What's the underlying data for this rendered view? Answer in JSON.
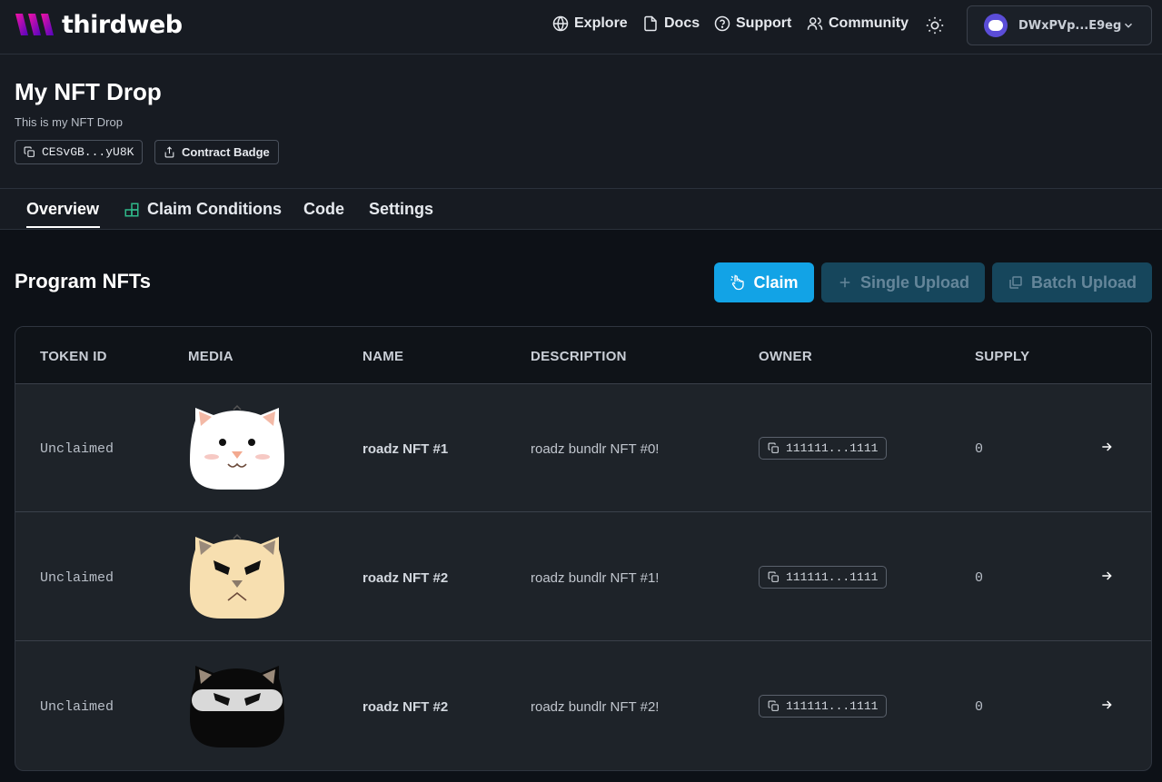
{
  "topbar": {
    "logo_text": "thirdweb",
    "nav": [
      {
        "label": "Explore",
        "icon": "globe-icon"
      },
      {
        "label": "Docs",
        "icon": "document-icon"
      },
      {
        "label": "Support",
        "icon": "help-circle-icon"
      },
      {
        "label": "Community",
        "icon": "users-icon"
      }
    ],
    "theme_icon": "sun-icon",
    "wallet_address": "DWxPVp...E9eg"
  },
  "contract": {
    "title": "My NFT Drop",
    "subtitle": "This is my NFT Drop",
    "address": "CESvGB...yU8K",
    "badge_label": "Contract Badge"
  },
  "tabs": [
    {
      "label": "Overview",
      "active": true
    },
    {
      "label": "Claim Conditions",
      "active": false
    },
    {
      "label": "Code",
      "active": false
    },
    {
      "label": "Settings",
      "active": false
    }
  ],
  "section": {
    "title": "Program NFTs",
    "claim_label": "Claim",
    "single_upload_label": "Single Upload",
    "batch_upload_label": "Batch Upload"
  },
  "table": {
    "columns": [
      "TOKEN ID",
      "MEDIA",
      "NAME",
      "DESCRIPTION",
      "OWNER",
      "SUPPLY"
    ],
    "rows": [
      {
        "token_id": "Unclaimed",
        "media": "white-cat-image",
        "name": "roadz NFT #1",
        "description": "roadz bundlr NFT #0!",
        "owner": "111111...1111",
        "supply": "0"
      },
      {
        "token_id": "Unclaimed",
        "media": "tan-cat-image",
        "name": "roadz NFT #2",
        "description": "roadz bundlr NFT #1!",
        "owner": "111111...1111",
        "supply": "0"
      },
      {
        "token_id": "Unclaimed",
        "media": "black-ninja-cat-image",
        "name": "roadz NFT #2",
        "description": "roadz bundlr NFT #2!",
        "owner": "111111...1111",
        "supply": "0"
      }
    ]
  },
  "colors": {
    "accent": "#12a3e6",
    "disabled_button": "#16465c",
    "background": "#0d1117",
    "panel": "#171b22",
    "brand_gradient_start": "#f213a4",
    "brand_gradient_end": "#5204bf"
  }
}
